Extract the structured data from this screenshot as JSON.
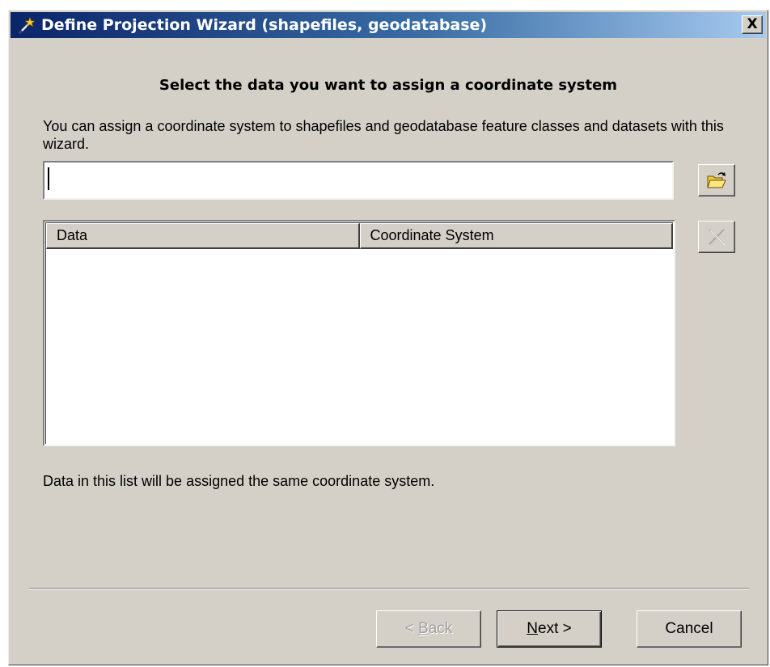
{
  "window": {
    "title": "Define Projection Wizard (shapefiles, geodatabase)",
    "close_label": "X"
  },
  "page": {
    "heading": "Select the data you want to assign a coordinate system",
    "description": "You can assign a coordinate system to shapefiles and geodatabase feature classes and datasets with this wizard.",
    "path_input_value": "",
    "footnote": "Data in this list will be assigned the same coordinate system."
  },
  "list": {
    "columns": [
      "Data",
      "Coordinate System"
    ],
    "rows": []
  },
  "buttons": {
    "back_prefix": "< ",
    "back_mnemonic": "B",
    "back_rest": "ack",
    "next_mnemonic": "N",
    "next_rest": "ext >",
    "cancel": "Cancel"
  },
  "icons": {
    "title": "wizard-wand-icon",
    "browse": "open-folder-icon",
    "remove": "delete-x-icon"
  },
  "colors": {
    "titlebar_start": "#0a246a",
    "titlebar_end": "#a6caf0",
    "dialog_face": "#d4d0c8"
  }
}
